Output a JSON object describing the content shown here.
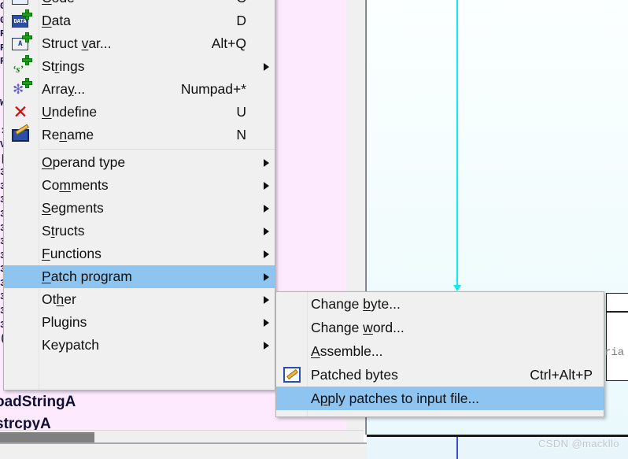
{
  "background": {
    "listing_lines": "G\nG\nR\nR\nR\n\n\nW\n\n:\nV\n|\n3\n3\n3\n3\n3\n3\n3\n3\n3\n3\n3\n3\n(",
    "listing_entry_1": "oadStringA",
    "listing_entry_2": "strcpyA",
    "graph_node_text": "ria",
    "watermark": "CSDN @mackllo"
  },
  "main_menu": {
    "name": "edit-context-menu",
    "items": [
      {
        "id": "code",
        "icon": "code-plus-icon",
        "label_pre": "",
        "label_accel": "C",
        "label_post": "ode",
        "shortcut": "C",
        "submenu": false,
        "highlight": false
      },
      {
        "id": "data",
        "icon": "data-plus-icon",
        "label_pre": "",
        "label_accel": "D",
        "label_post": "ata",
        "shortcut": "D",
        "submenu": false,
        "highlight": false
      },
      {
        "id": "struct-var",
        "icon": "struct-var-plus-icon",
        "label_pre": "Struct ",
        "label_accel": "v",
        "label_post": "ar...",
        "shortcut": "Alt+Q",
        "submenu": false,
        "highlight": false
      },
      {
        "id": "strings",
        "icon": "strings-plus-icon",
        "label_pre": "St",
        "label_accel": "r",
        "label_post": "ings",
        "shortcut": "",
        "submenu": true,
        "highlight": false
      },
      {
        "id": "array",
        "icon": "array-plus-icon",
        "label_pre": "Arra",
        "label_accel": "y",
        "label_post": "...",
        "shortcut": "Numpad+*",
        "submenu": false,
        "highlight": false
      },
      {
        "id": "undefine",
        "icon": "undefine-x-icon",
        "label_pre": "",
        "label_accel": "U",
        "label_post": "ndefine",
        "shortcut": "U",
        "submenu": false,
        "highlight": false
      },
      {
        "id": "rename",
        "icon": "rename-icon",
        "label_pre": "Re",
        "label_accel": "n",
        "label_post": "ame",
        "shortcut": "N",
        "submenu": false,
        "highlight": false
      },
      {
        "id": "separator-1",
        "separator": true
      },
      {
        "id": "operand-type",
        "icon": "",
        "label_pre": "",
        "label_accel": "O",
        "label_post": "perand type",
        "shortcut": "",
        "submenu": true,
        "highlight": false
      },
      {
        "id": "comments",
        "icon": "",
        "label_pre": "Co",
        "label_accel": "m",
        "label_post": "ments",
        "shortcut": "",
        "submenu": true,
        "highlight": false
      },
      {
        "id": "segments",
        "icon": "",
        "label_pre": "",
        "label_accel": "S",
        "label_post": "egments",
        "shortcut": "",
        "submenu": true,
        "highlight": false
      },
      {
        "id": "structs",
        "icon": "",
        "label_pre": "S",
        "label_accel": "t",
        "label_post": "ructs",
        "shortcut": "",
        "submenu": true,
        "highlight": false
      },
      {
        "id": "functions",
        "icon": "",
        "label_pre": "",
        "label_accel": "F",
        "label_post": "unctions",
        "shortcut": "",
        "submenu": true,
        "highlight": false
      },
      {
        "id": "patch-program",
        "icon": "",
        "label_pre": "",
        "label_accel": "P",
        "label_post": "atch program",
        "shortcut": "",
        "submenu": true,
        "highlight": true
      },
      {
        "id": "other",
        "icon": "",
        "label_pre": "Ot",
        "label_accel": "h",
        "label_post": "er",
        "shortcut": "",
        "submenu": true,
        "highlight": false
      },
      {
        "id": "plugins",
        "icon": "",
        "label_pre": "Plu",
        "label_accel": "g",
        "label_post": "ins",
        "shortcut": "",
        "submenu": true,
        "highlight": false
      },
      {
        "id": "keypatch",
        "icon": "",
        "label_pre": "Keypatch",
        "label_accel": "",
        "label_post": "",
        "shortcut": "",
        "submenu": true,
        "highlight": false
      }
    ]
  },
  "sub_menu": {
    "name": "patch-program-submenu",
    "items": [
      {
        "id": "change-byte",
        "icon": "",
        "label_pre": "Change ",
        "label_accel": "b",
        "label_post": "yte...",
        "shortcut": "",
        "highlight": false
      },
      {
        "id": "change-word",
        "icon": "",
        "label_pre": "Change ",
        "label_accel": "w",
        "label_post": "ord...",
        "shortcut": "",
        "highlight": false
      },
      {
        "id": "assemble",
        "icon": "",
        "label_pre": "",
        "label_accel": "A",
        "label_post": "ssemble...",
        "shortcut": "",
        "highlight": false
      },
      {
        "id": "patched-bytes",
        "icon": "patched-bytes-icon",
        "label_pre": "Patched bytes",
        "label_accel": "",
        "label_post": "",
        "shortcut": "Ctrl+Alt+P",
        "highlight": false
      },
      {
        "id": "apply-patches",
        "icon": "",
        "label_pre": "A",
        "label_accel": "p",
        "label_post": "ply patches to input file...",
        "shortcut": "",
        "highlight": true
      }
    ]
  },
  "colors": {
    "menu_background": "#f0f0f0",
    "menu_highlight": "#8ec5f0",
    "listing_background": "#fdeaff",
    "graph_background": "#f2fcfd",
    "graph_edge": "#10e8f2",
    "scrollbar_thumb": "#808080"
  }
}
